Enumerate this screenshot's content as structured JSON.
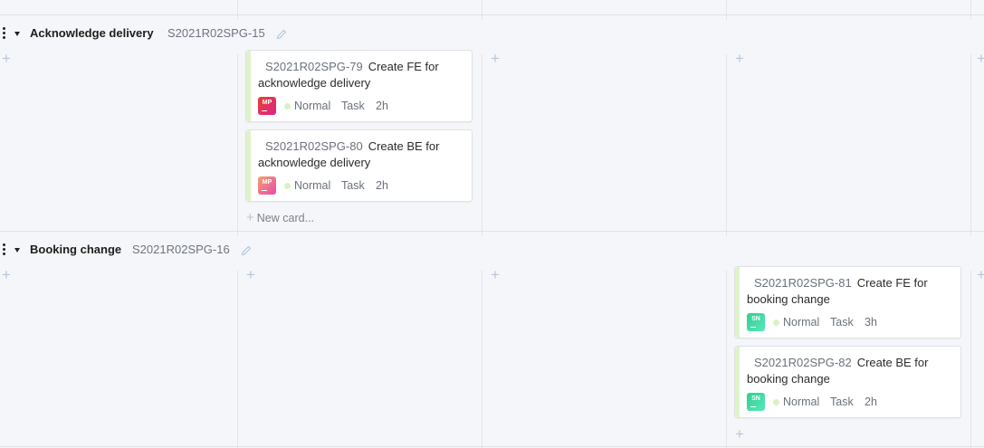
{
  "swimlanes": [
    {
      "title": "Acknowledge delivery",
      "key": "S2021R02SPG-15",
      "cards": [
        {
          "key": "S2021R02SPG-79",
          "title": "Create FE for acknowledge delivery",
          "avatar": "MP",
          "priority": "Normal",
          "type": "Task",
          "estimate": "2h"
        },
        {
          "key": "S2021R02SPG-80",
          "title": "Create BE for acknowledge delivery",
          "avatar": "MP",
          "priority": "Normal",
          "type": "Task",
          "estimate": "2h"
        }
      ],
      "new_card_label": "New card..."
    },
    {
      "title": "Booking change",
      "key": "S2021R02SPG-16",
      "cards": [
        {
          "key": "S2021R02SPG-81",
          "title": "Create FE for booking change",
          "avatar": "SN",
          "priority": "Normal",
          "type": "Task",
          "estimate": "3h"
        },
        {
          "key": "S2021R02SPG-82",
          "title": "Create BE for booking change",
          "avatar": "SN",
          "priority": "Normal",
          "type": "Task",
          "estimate": "2h"
        }
      ]
    }
  ],
  "colors": {
    "avatar_mp_1": "#e8422f",
    "avatar_mp_2": "#f26b8a",
    "avatar_sn": "#3bd9a0",
    "card_stripe": "#dff3c9",
    "priority_dot": "#d9f2c4"
  },
  "icons": [
    "drag-handle-icon",
    "collapse-caret-icon",
    "edit-pencil-icon",
    "add-plus-icon"
  ]
}
